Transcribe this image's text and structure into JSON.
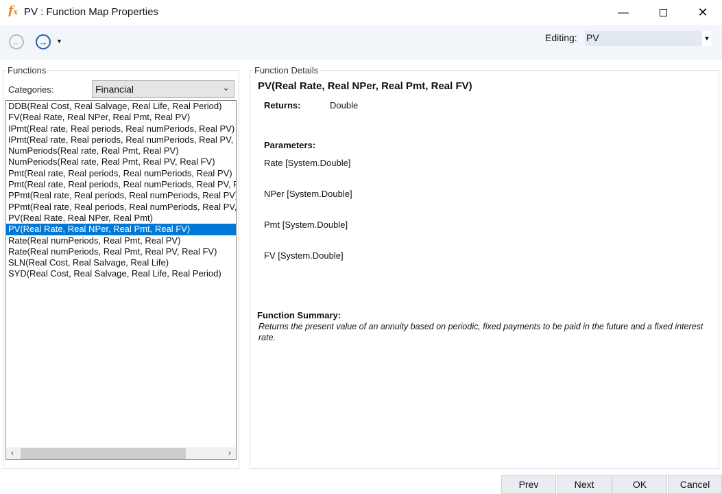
{
  "window": {
    "title": "PV : Function Map Properties",
    "icon": "fx-icon"
  },
  "toolbar": {
    "back_icon": "back-arrow-icon",
    "forward_icon": "forward-arrow-icon",
    "editing_label": "Editing:",
    "editing_value": "PV"
  },
  "functions": {
    "legend": "Functions",
    "categories_label": "Categories:",
    "category_value": "Financial",
    "items": [
      "DDB(Real Cost, Real Salvage, Real Life, Real Period)",
      "FV(Real Rate, Real NPer, Real Pmt, Real PV)",
      "IPmt(Real rate, Real periods, Real numPeriods, Real PV)",
      "IPmt(Real rate, Real periods, Real numPeriods, Real PV, Real FV)",
      "NumPeriods(Real rate, Real Pmt, Real PV)",
      "NumPeriods(Real rate, Real Pmt, Real PV, Real FV)",
      "Pmt(Real rate, Real periods, Real numPeriods, Real PV)",
      "Pmt(Real rate, Real periods, Real numPeriods, Real PV, Real FV)",
      "PPmt(Real rate, Real periods, Real numPeriods, Real PV)",
      "PPmt(Real rate, Real periods, Real numPeriods, Real PV, Real FV)",
      "PV(Real Rate, Real NPer, Real Pmt)",
      "PV(Real Rate, Real NPer, Real Pmt, Real FV)",
      "Rate(Real numPeriods, Real Pmt, Real PV)",
      "Rate(Real numPeriods, Real Pmt, Real PV, Real FV)",
      "SLN(Real Cost, Real Salvage, Real Life)",
      "SYD(Real Cost, Real Salvage, Real Life, Real Period)"
    ],
    "selected_index": 11
  },
  "details": {
    "legend": "Function Details",
    "signature": "PV(Real Rate, Real NPer, Real Pmt, Real FV)",
    "returns_label": "Returns:",
    "returns_value": "Double",
    "parameters_label": "Parameters:",
    "parameters": [
      "Rate [System.Double]",
      "NPer [System.Double]",
      "Pmt [System.Double]",
      "FV [System.Double]"
    ],
    "summary_label": "Function Summary:",
    "summary_text": "Returns the present value of an annuity based on periodic, fixed payments to be paid in the future and a fixed interest rate."
  },
  "buttons": {
    "prev": "Prev",
    "next": "Next",
    "ok": "OK",
    "cancel": "Cancel"
  }
}
